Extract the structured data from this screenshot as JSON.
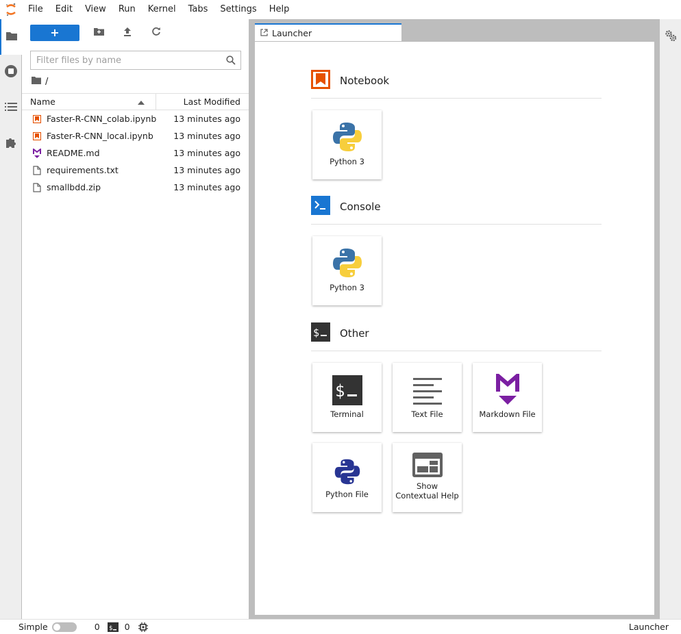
{
  "menu": {
    "items": [
      "File",
      "Edit",
      "View",
      "Run",
      "Kernel",
      "Tabs",
      "Settings",
      "Help"
    ]
  },
  "activity": {
    "tabs": [
      "folder-icon",
      "running-icon",
      "toc-icon",
      "extension-icon"
    ]
  },
  "filebrowser": {
    "new_label": "+",
    "search_placeholder": "Filter files by name",
    "breadcrumb": "/",
    "col_name": "Name",
    "col_modified": "Last Modified",
    "files": [
      {
        "name": "Faster-R-CNN_colab.ipynb",
        "modified": "13 minutes ago",
        "icon": "notebook-icon"
      },
      {
        "name": "Faster-R-CNN_local.ipynb",
        "modified": "13 minutes ago",
        "icon": "notebook-icon"
      },
      {
        "name": "README.md",
        "modified": "13 minutes ago",
        "icon": "markdown-icon"
      },
      {
        "name": "requirements.txt",
        "modified": "13 minutes ago",
        "icon": "file-icon"
      },
      {
        "name": "smallbdd.zip",
        "modified": "13 minutes ago",
        "icon": "file-icon"
      }
    ]
  },
  "tab": {
    "label": "Launcher"
  },
  "launcher": {
    "notebook": {
      "title": "Notebook",
      "cards": [
        "Python 3"
      ]
    },
    "console": {
      "title": "Console",
      "cards": [
        "Python 3"
      ]
    },
    "other": {
      "title": "Other",
      "cards": [
        "Terminal",
        "Text File",
        "Markdown File",
        "Python File",
        "Show Contextual Help"
      ]
    }
  },
  "status": {
    "mode_label": "Simple",
    "terminals": "0",
    "kernels": "0",
    "current": "Launcher"
  },
  "colors": {
    "accent": "#1976d2",
    "notebook_orange": "#e65100",
    "markdown_purple": "#7b1fa2"
  }
}
